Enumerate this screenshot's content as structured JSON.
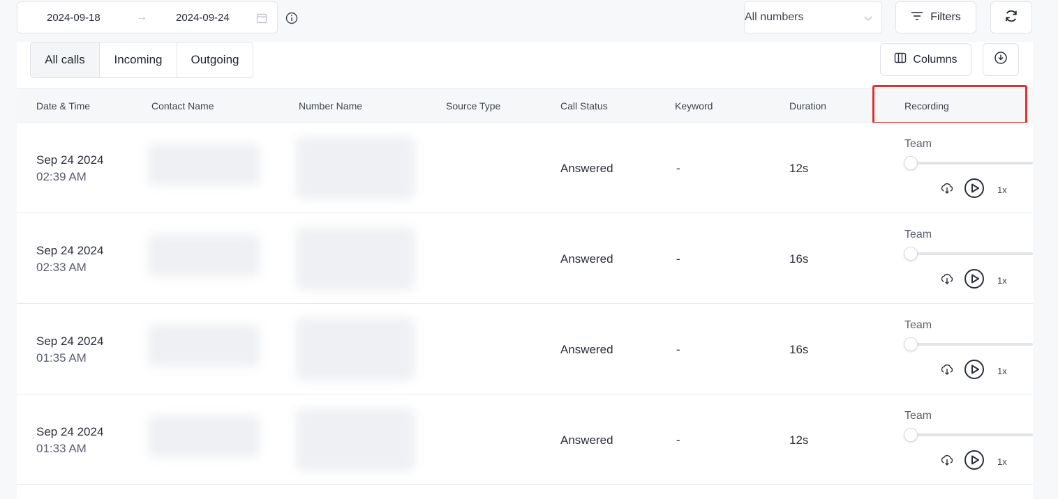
{
  "toolbar": {
    "date_from": "2024-09-18",
    "date_to": "2024-09-24",
    "number_select": "All numbers",
    "filters_label": "Filters"
  },
  "tabs": [
    {
      "label": "All calls",
      "active": true
    },
    {
      "label": "Incoming",
      "active": false
    },
    {
      "label": "Outgoing",
      "active": false
    }
  ],
  "actions": {
    "columns_label": "Columns"
  },
  "columns": [
    "Date & Time",
    "Contact Name",
    "Number Name",
    "Source Type",
    "Call Status",
    "Keyword",
    "Duration",
    "Recording"
  ],
  "rows": [
    {
      "date": "Sep 24 2024",
      "time": "02:39 AM",
      "status": "Answered",
      "keyword": "-",
      "duration": "12s",
      "recording": {
        "label": "Team",
        "progress": 0,
        "speed": "1x"
      }
    },
    {
      "date": "Sep 24 2024",
      "time": "02:33 AM",
      "status": "Answered",
      "keyword": "-",
      "duration": "16s",
      "recording": {
        "label": "Team",
        "progress": 0,
        "speed": "1x"
      }
    },
    {
      "date": "Sep 24 2024",
      "time": "01:35 AM",
      "status": "Answered",
      "keyword": "-",
      "duration": "16s",
      "recording": {
        "label": "Team",
        "progress": 0,
        "speed": "1x"
      }
    },
    {
      "date": "Sep 24 2024",
      "time": "01:33 AM",
      "status": "Answered",
      "keyword": "-",
      "duration": "12s",
      "recording": {
        "label": "Team",
        "progress": 0,
        "speed": "1x"
      }
    }
  ],
  "highlight": {
    "column": "Recording",
    "color": "#e03131"
  }
}
